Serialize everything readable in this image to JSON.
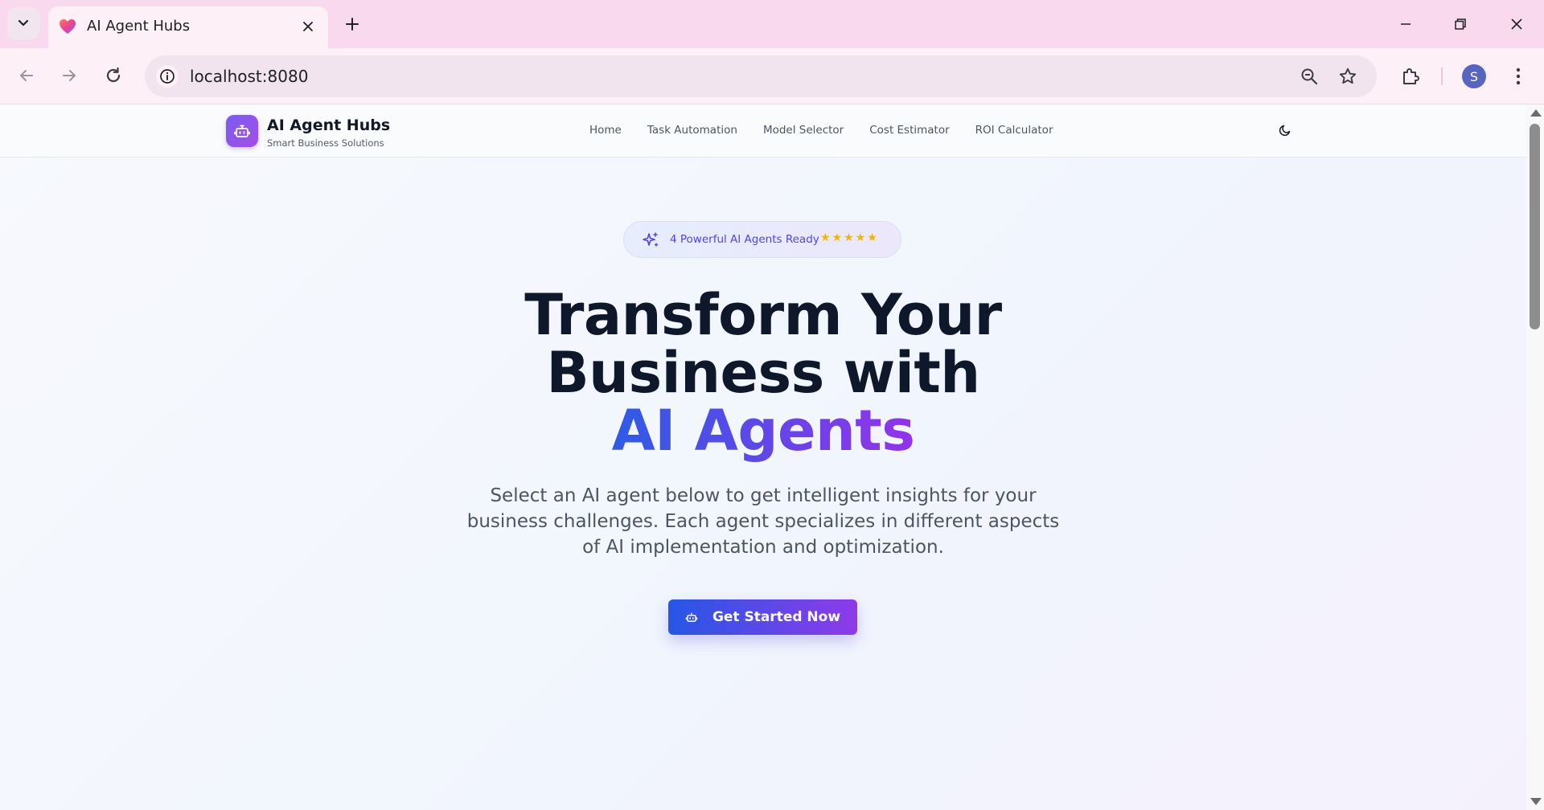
{
  "browser": {
    "tab_title": "AI Agent Hubs",
    "url": "localhost:8080",
    "profile_initial": "S"
  },
  "site": {
    "brand_name": "AI Agent Hubs",
    "brand_tagline": "Smart Business Solutions",
    "nav": [
      {
        "label": "Home"
      },
      {
        "label": "Task Automation"
      },
      {
        "label": "Model Selector"
      },
      {
        "label": "Cost Estimator"
      },
      {
        "label": "ROI Calculator"
      }
    ]
  },
  "hero": {
    "badge_text": "4 Powerful AI Agents Ready",
    "badge_stars": "★★★★★",
    "headline_line1": "Transform Your",
    "headline_line2": "Business with",
    "headline_highlight": "AI Agents",
    "subtitle": "Select an AI agent below to get intelligent insights for your business challenges. Each agent specializes in different aspects of AI implementation and optimization.",
    "cta_label": "Get Started Now"
  },
  "colors": {
    "accent_blue": "#2557e6",
    "accent_purple": "#9333ea",
    "star": "#f5b400"
  }
}
